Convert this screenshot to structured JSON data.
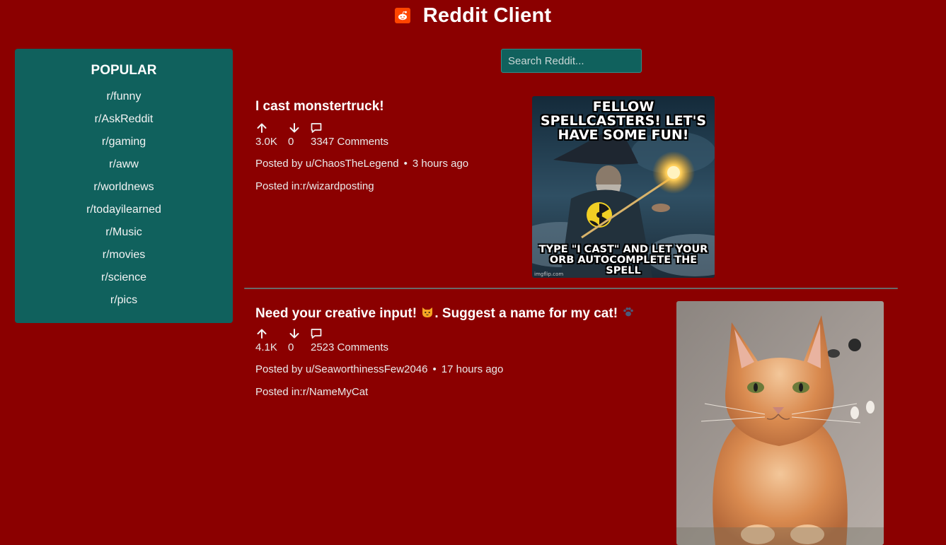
{
  "app": {
    "title": "Reddit Client",
    "logo_icon": "reddit-alien-icon"
  },
  "sidebar": {
    "title": "POPULAR",
    "items": [
      {
        "label": "r/funny"
      },
      {
        "label": "r/AskReddit"
      },
      {
        "label": "r/gaming"
      },
      {
        "label": "r/aww"
      },
      {
        "label": "r/worldnews"
      },
      {
        "label": "r/todayilearned"
      },
      {
        "label": "r/Music"
      },
      {
        "label": "r/movies"
      },
      {
        "label": "r/science"
      },
      {
        "label": "r/pics"
      }
    ]
  },
  "search": {
    "placeholder": "Search Reddit..."
  },
  "posts": [
    {
      "title": "I cast monstertruck!",
      "upvotes": "3.0K",
      "downvotes": "0",
      "comments": "3347 Comments",
      "posted_by": "Posted by u/ChaosTheLegend",
      "time": "3 hours ago",
      "posted_in": "Posted in:r/wizardposting",
      "image": {
        "top_text": "FELLOW SPELLCASTERS! LET'S HAVE SOME FUN!",
        "bottom_text": "TYPE \"I CAST\" AND LET YOUR ORB AUTOCOMPLETE THE SPELL",
        "credit": "imgflip.com"
      }
    },
    {
      "title_text": "Need your creative input! ",
      "title_emoji_1": "cat-face-emoji",
      "title_mid": ". Suggest a name for my cat! ",
      "title_emoji_2": "paw-prints-emoji",
      "upvotes": "4.1K",
      "downvotes": "0",
      "comments": "2523 Comments",
      "posted_by": "Posted by u/SeaworthinessFew2046",
      "time": "17 hours ago",
      "posted_in": "Posted in:r/NameMyCat"
    }
  ],
  "colors": {
    "background": "#8b0000",
    "panel": "#10615d",
    "divider": "#6a6a6a"
  }
}
